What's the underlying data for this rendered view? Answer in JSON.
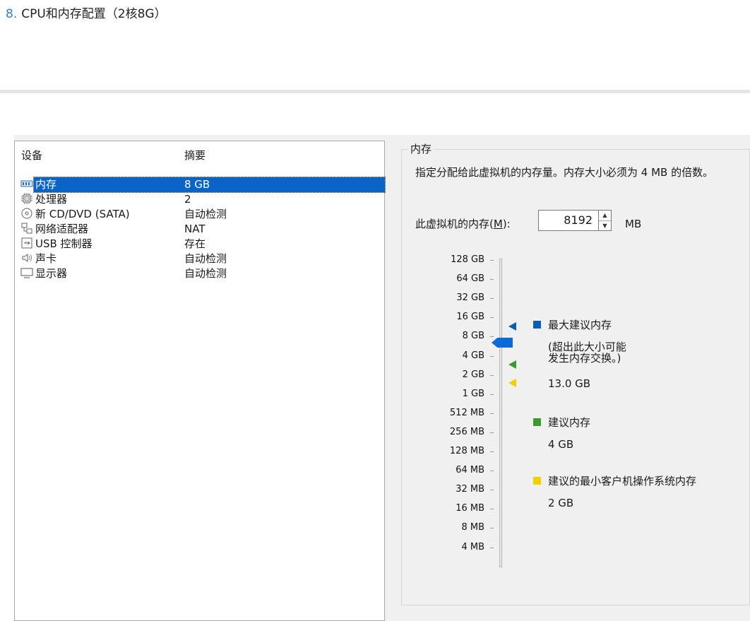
{
  "heading": {
    "number": "8.",
    "text": "CPU和内存配置（2核8G）"
  },
  "device_list": {
    "columns": [
      "设备",
      "摘要"
    ],
    "rows": [
      {
        "icon": "memory-icon",
        "name": "内存",
        "value": "8 GB",
        "selected": true
      },
      {
        "icon": "processor-icon",
        "name": "处理器",
        "value": "2"
      },
      {
        "icon": "cd-dvd-icon",
        "name": "新 CD/DVD (SATA)",
        "value": "自动检测"
      },
      {
        "icon": "network-adapter-icon",
        "name": "网络适配器",
        "value": "NAT"
      },
      {
        "icon": "usb-icon",
        "name": "USB 控制器",
        "value": "存在"
      },
      {
        "icon": "sound-card-icon",
        "name": "声卡",
        "value": "自动检测"
      },
      {
        "icon": "display-icon",
        "name": "显示器",
        "value": "自动检测"
      }
    ]
  },
  "memory": {
    "group_title": "内存",
    "description": "指定分配给此虚拟机的内存量。内存大小必须为 4 MB 的倍数。",
    "label_prefix": "此虚拟机的内存(",
    "label_key": "M",
    "label_suffix": "):",
    "value": "8192",
    "unit": "MB",
    "scale": [
      "128 GB",
      "64 GB",
      "32 GB",
      "16 GB",
      "8 GB",
      "4 GB",
      "2 GB",
      "1 GB",
      "512 MB",
      "256 MB",
      "128 MB",
      "64 MB",
      "32 MB",
      "16 MB",
      "8 MB",
      "4 MB"
    ],
    "slider_value": "8 GB",
    "legend": {
      "max": {
        "title": "最大建议内存",
        "note_line1": "(超出此大小可能",
        "note_line2": "发生内存交换。)",
        "value": "13.0 GB",
        "color": "#0b5fb3"
      },
      "recommended": {
        "title": "建议内存",
        "value": "4 GB",
        "color": "#3a9a2a"
      },
      "min": {
        "title": "建议的最小客户机操作系统内存",
        "value": "2 GB",
        "color": "#f2d000"
      }
    }
  }
}
